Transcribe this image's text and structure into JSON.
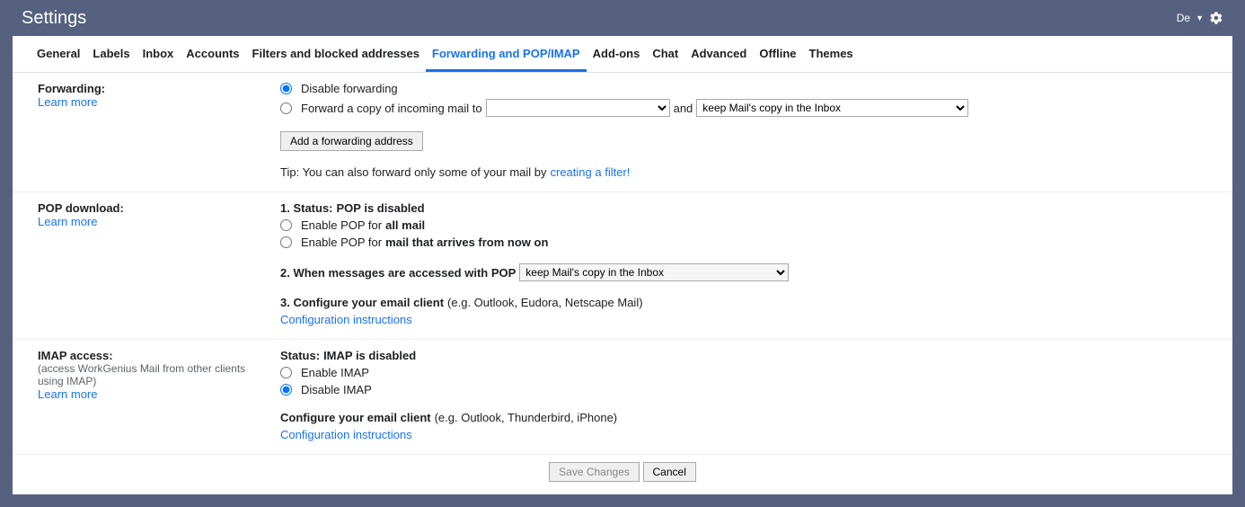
{
  "header": {
    "title": "Settings",
    "lang": "De"
  },
  "tabs": [
    "General",
    "Labels",
    "Inbox",
    "Accounts",
    "Filters and blocked addresses",
    "Forwarding and POP/IMAP",
    "Add-ons",
    "Chat",
    "Advanced",
    "Offline",
    "Themes"
  ],
  "forwarding": {
    "label": "Forwarding:",
    "learn_more": "Learn more",
    "disable": "Disable forwarding",
    "forward_prefix": "Forward a copy of incoming mail to",
    "address_option": " ",
    "and": "and",
    "action_option": "keep                Mail's copy in the Inbox",
    "add_button": "Add a forwarding address",
    "tip_prefix": "Tip: You can also forward only some of your mail by ",
    "tip_link": "creating a filter!"
  },
  "pop": {
    "label": "POP download:",
    "learn_more": "Learn more",
    "status_prefix": "1. Status: ",
    "status_value": "POP is disabled",
    "enable_all_prefix": "Enable POP for ",
    "enable_all_bold": "all mail",
    "enable_now_prefix": "Enable POP for ",
    "enable_now_bold": "mail that arrives from now on",
    "when_label": "2. When messages are accessed with POP",
    "when_option": "keep                Mail's copy in the Inbox",
    "configure_bold": "3. Configure your email client ",
    "configure_rest": "(e.g. Outlook, Eudora, Netscape Mail)",
    "config_link": "Configuration instructions"
  },
  "imap": {
    "label": "IMAP access:",
    "sub": "(access WorkGenius Mail from other clients using IMAP)",
    "learn_more": "Learn more",
    "status_prefix": "Status: ",
    "status_value": "IMAP is disabled",
    "enable": "Enable IMAP",
    "disable": "Disable IMAP",
    "configure_bold": "Configure your email client ",
    "configure_rest": "(e.g. Outlook, Thunderbird, iPhone)",
    "config_link": "Configuration instructions"
  },
  "footer": {
    "save": "Save Changes",
    "cancel": "Cancel"
  }
}
